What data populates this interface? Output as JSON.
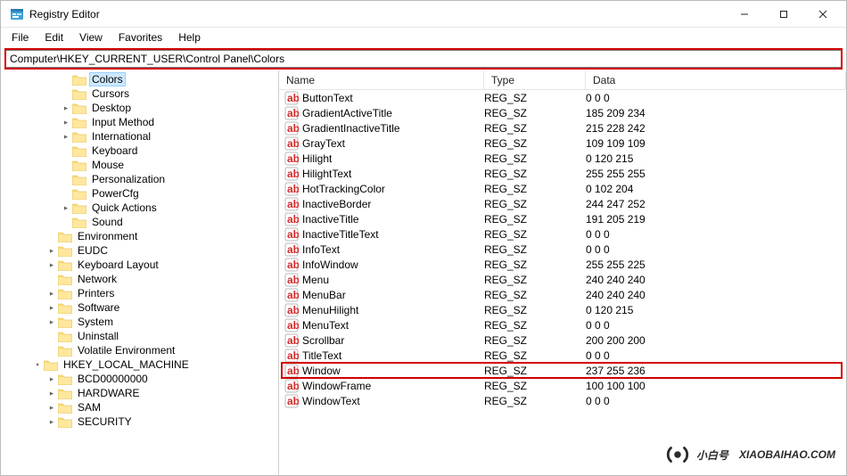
{
  "window": {
    "title": "Registry Editor"
  },
  "menubar": {
    "file": "File",
    "edit": "Edit",
    "view": "View",
    "favorites": "Favorites",
    "help": "Help"
  },
  "address": {
    "value": "Computer\\HKEY_CURRENT_USER\\Control Panel\\Colors"
  },
  "tree": {
    "selected": "Colors",
    "items": [
      {
        "indent": 4,
        "twist": "",
        "label": "Colors",
        "selected": true
      },
      {
        "indent": 4,
        "twist": "",
        "label": "Cursors"
      },
      {
        "indent": 4,
        "twist": ">",
        "label": "Desktop"
      },
      {
        "indent": 4,
        "twist": ">",
        "label": "Input Method"
      },
      {
        "indent": 4,
        "twist": ">",
        "label": "International"
      },
      {
        "indent": 4,
        "twist": "",
        "label": "Keyboard"
      },
      {
        "indent": 4,
        "twist": "",
        "label": "Mouse"
      },
      {
        "indent": 4,
        "twist": "",
        "label": "Personalization"
      },
      {
        "indent": 4,
        "twist": "",
        "label": "PowerCfg"
      },
      {
        "indent": 4,
        "twist": ">",
        "label": "Quick Actions"
      },
      {
        "indent": 4,
        "twist": "",
        "label": "Sound"
      },
      {
        "indent": 3,
        "twist": "",
        "label": "Environment"
      },
      {
        "indent": 3,
        "twist": ">",
        "label": "EUDC"
      },
      {
        "indent": 3,
        "twist": ">",
        "label": "Keyboard Layout"
      },
      {
        "indent": 3,
        "twist": "",
        "label": "Network"
      },
      {
        "indent": 3,
        "twist": ">",
        "label": "Printers"
      },
      {
        "indent": 3,
        "twist": ">",
        "label": "Software"
      },
      {
        "indent": 3,
        "twist": ">",
        "label": "System"
      },
      {
        "indent": 3,
        "twist": "",
        "label": "Uninstall"
      },
      {
        "indent": 3,
        "twist": "",
        "label": "Volatile Environment"
      },
      {
        "indent": 2,
        "twist": "v",
        "label": "HKEY_LOCAL_MACHINE"
      },
      {
        "indent": 3,
        "twist": ">",
        "label": "BCD00000000"
      },
      {
        "indent": 3,
        "twist": ">",
        "label": "HARDWARE"
      },
      {
        "indent": 3,
        "twist": ">",
        "label": "SAM"
      },
      {
        "indent": 3,
        "twist": ">",
        "label": "SECURITY"
      }
    ]
  },
  "list": {
    "header": {
      "name": "Name",
      "type": "Type",
      "data": "Data"
    },
    "highlight": "Window",
    "rows": [
      {
        "name": "ButtonText",
        "type": "REG_SZ",
        "data": "0 0 0"
      },
      {
        "name": "GradientActiveTitle",
        "type": "REG_SZ",
        "data": "185 209 234"
      },
      {
        "name": "GradientInactiveTitle",
        "type": "REG_SZ",
        "data": "215 228 242"
      },
      {
        "name": "GrayText",
        "type": "REG_SZ",
        "data": "109 109 109"
      },
      {
        "name": "Hilight",
        "type": "REG_SZ",
        "data": "0 120 215"
      },
      {
        "name": "HilightText",
        "type": "REG_SZ",
        "data": "255 255 255"
      },
      {
        "name": "HotTrackingColor",
        "type": "REG_SZ",
        "data": "0 102 204"
      },
      {
        "name": "InactiveBorder",
        "type": "REG_SZ",
        "data": "244 247 252"
      },
      {
        "name": "InactiveTitle",
        "type": "REG_SZ",
        "data": "191 205 219"
      },
      {
        "name": "InactiveTitleText",
        "type": "REG_SZ",
        "data": "0 0 0"
      },
      {
        "name": "InfoText",
        "type": "REG_SZ",
        "data": "0 0 0"
      },
      {
        "name": "InfoWindow",
        "type": "REG_SZ",
        "data": "255 255 225"
      },
      {
        "name": "Menu",
        "type": "REG_SZ",
        "data": "240 240 240"
      },
      {
        "name": "MenuBar",
        "type": "REG_SZ",
        "data": "240 240 240"
      },
      {
        "name": "MenuHilight",
        "type": "REG_SZ",
        "data": "0 120 215"
      },
      {
        "name": "MenuText",
        "type": "REG_SZ",
        "data": "0 0 0"
      },
      {
        "name": "Scrollbar",
        "type": "REG_SZ",
        "data": "200 200 200"
      },
      {
        "name": "TitleText",
        "type": "REG_SZ",
        "data": "0 0 0"
      },
      {
        "name": "Window",
        "type": "REG_SZ",
        "data": "237 255 236"
      },
      {
        "name": "WindowFrame",
        "type": "REG_SZ",
        "data": "100 100 100"
      },
      {
        "name": "WindowText",
        "type": "REG_SZ",
        "data": "0 0 0"
      }
    ]
  },
  "watermark": {
    "text": "小白号",
    "domain": "XIAOBAIHAO.COM"
  }
}
